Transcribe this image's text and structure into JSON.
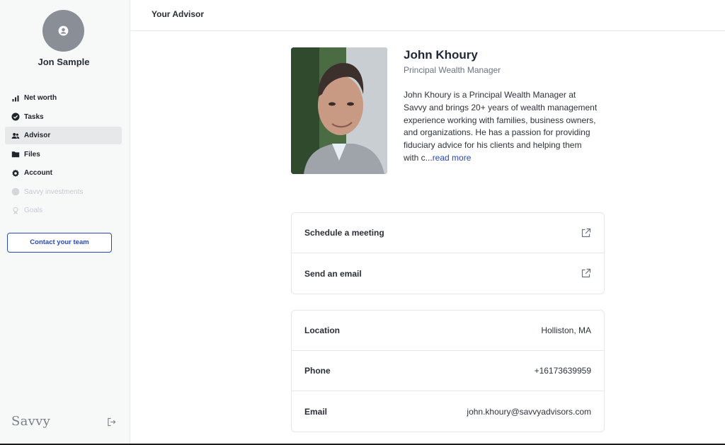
{
  "sidebar": {
    "user_name": "Jon Sample",
    "avatar_icon": "user-circle-icon",
    "items": [
      {
        "label": "Net worth",
        "icon": "bar-chart-icon",
        "active": false,
        "disabled": false
      },
      {
        "label": "Tasks",
        "icon": "check-circle-icon",
        "active": false,
        "disabled": false
      },
      {
        "label": "Advisor",
        "icon": "people-icon",
        "active": true,
        "disabled": false
      },
      {
        "label": "Files",
        "icon": "folder-icon",
        "active": false,
        "disabled": false
      },
      {
        "label": "Account",
        "icon": "gear-icon",
        "active": false,
        "disabled": false
      },
      {
        "label": "Savvy investments",
        "icon": "circle-icon",
        "active": false,
        "disabled": true
      },
      {
        "label": "Goals",
        "icon": "goal-icon",
        "active": false,
        "disabled": true
      }
    ],
    "contact_button": "Contact your team",
    "brand": "Savvy",
    "logout_icon": "logout-icon"
  },
  "header": {
    "title": "Your Advisor"
  },
  "advisor": {
    "name": "John Khoury",
    "title": "Principal Wealth Manager",
    "bio": "John Khoury is a Principal Wealth Manager at Savvy and brings 20+ years of wealth management experience working with families, business owners, and organizations. He has a passion for providing fiduciary advice for his clients and helping them with c...",
    "read_more": "read more"
  },
  "actions": [
    {
      "label": "Schedule a meeting",
      "icon": "external-link-icon"
    },
    {
      "label": "Send an email",
      "icon": "external-link-icon"
    }
  ],
  "details": [
    {
      "label": "Location",
      "value": "Holliston, MA"
    },
    {
      "label": "Phone",
      "value": "+16173639959"
    },
    {
      "label": "Email",
      "value": "john.khoury@savvyadvisors.com"
    }
  ],
  "colors": {
    "accent": "#2848b8",
    "sidebar_bg": "#f7f8f8",
    "active_bg": "#e6e8ea",
    "disabled_text": "#c6cbd1"
  }
}
